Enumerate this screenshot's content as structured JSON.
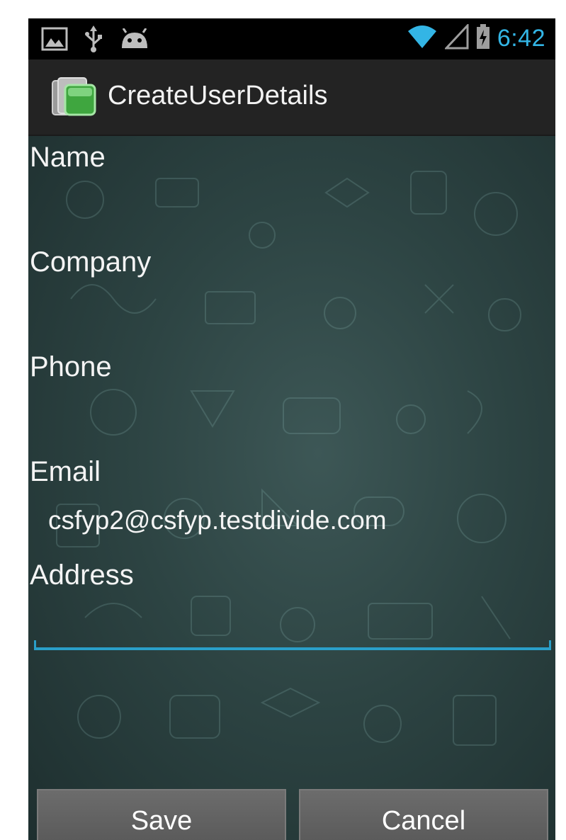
{
  "status_bar": {
    "time": "6:42",
    "icons": [
      "image-icon",
      "usb-icon",
      "android-debug-icon",
      "wifi-icon",
      "signal-icon",
      "battery-icon"
    ],
    "time_color": "#33b5e5"
  },
  "action_bar": {
    "title": "CreateUserDetails",
    "icon": "folder-app-icon"
  },
  "form": {
    "fields": [
      {
        "label": "Name",
        "value": ""
      },
      {
        "label": "Company",
        "value": ""
      },
      {
        "label": "Phone",
        "value": ""
      },
      {
        "label": "Email",
        "value": "csfyp2@csfyp.testdivide.com"
      },
      {
        "label": "Address",
        "value": ""
      }
    ],
    "focus_color": "#2a9fc9"
  },
  "buttons": {
    "save": "Save",
    "cancel": "Cancel"
  }
}
